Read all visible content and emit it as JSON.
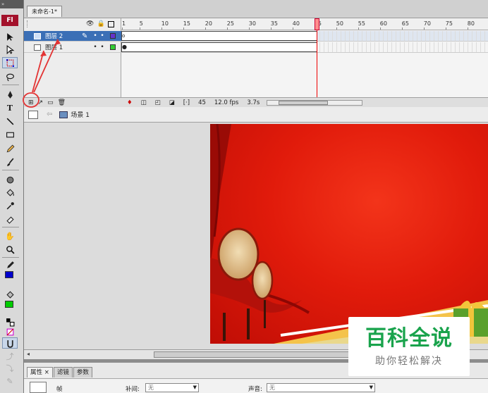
{
  "app": {
    "logo": "Fl",
    "grip": "»"
  },
  "document": {
    "tab_title": "未命名-1*"
  },
  "timeline": {
    "ruler_ticks": [
      "1",
      "5",
      "10",
      "15",
      "20",
      "25",
      "30",
      "35",
      "40",
      "45",
      "50",
      "55",
      "60",
      "65",
      "70",
      "75",
      "80"
    ],
    "layers": [
      {
        "name": "图层 2",
        "color": "#6633cc",
        "selected": true
      },
      {
        "name": "图层 1",
        "color": "#33cc33",
        "selected": false
      }
    ],
    "status": {
      "current_frame": "45",
      "frame_rate": "12.0 fps",
      "elapsed": "3.7s"
    }
  },
  "editbar": {
    "scene_label": "场景 1"
  },
  "toolbox": {
    "stroke_color": "#0000cc",
    "fill_color": "#00cc00"
  },
  "properties": {
    "tabs": [
      {
        "label": "属性",
        "active": true,
        "closable": true
      },
      {
        "label": "滤镜",
        "active": false
      },
      {
        "label": "参数",
        "active": false
      }
    ],
    "frame_label": "帧",
    "tween_label": "补间:",
    "tween_value": "无",
    "sound_label": "声音:",
    "sound_value": "无"
  },
  "watermark": {
    "title": "百科全说",
    "subtitle": "助你轻松解决"
  },
  "colors": {
    "stage_red": "#e11b0b",
    "accent_annotation": "#e33333",
    "watermark_green": "#19a34c"
  }
}
